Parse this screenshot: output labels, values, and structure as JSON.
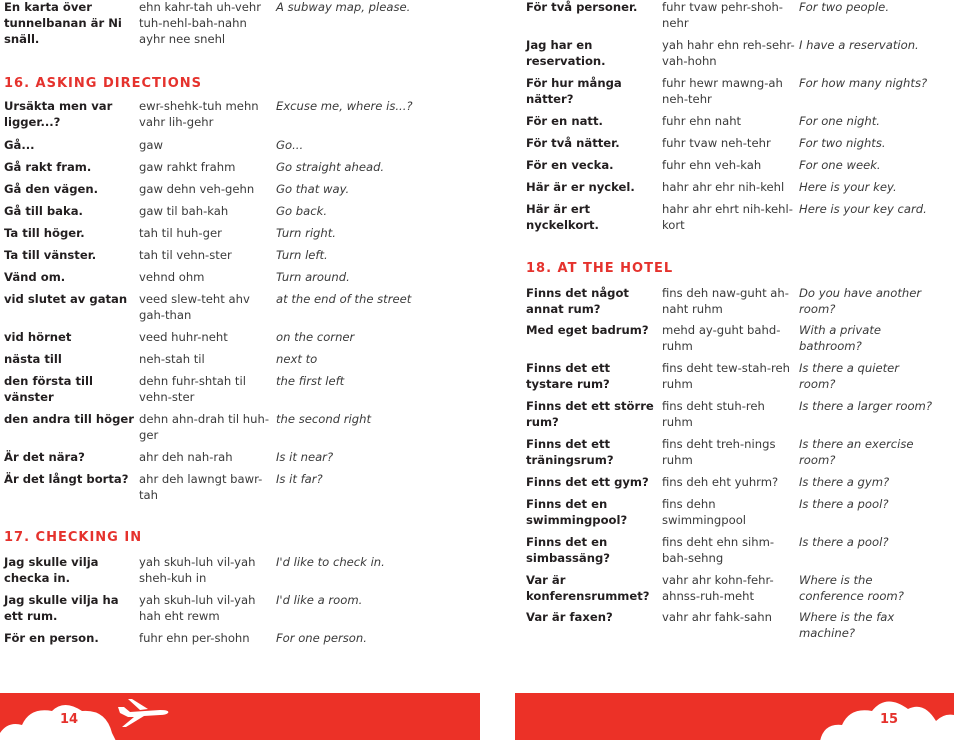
{
  "pages": [
    {
      "page_number": "14",
      "blocks": [
        {
          "type": "rows",
          "rows": [
            {
              "sv": "En karta över tunnelbanan är Ni snäll.",
              "pron": "ehn kahr-tah uh-vehr tuh-nehl-bah-nahn ayhr nee snehl",
              "en": "A subway map, please."
            }
          ]
        },
        {
          "type": "heading",
          "text": "16. ASKING DIRECTIONS"
        },
        {
          "type": "rows",
          "rows": [
            {
              "sv": "Ursäkta men var ligger...?",
              "pron": "ewr-shehk-tuh mehn vahr lih-gehr",
              "en": "Excuse me, where is...?"
            },
            {
              "sv": "Gå...",
              "pron": "gaw",
              "en": "Go..."
            },
            {
              "sv": "Gå rakt fram.",
              "pron": "gaw rahkt frahm",
              "en": "Go straight ahead."
            },
            {
              "sv": "Gå den vägen.",
              "pron": "gaw dehn veh-gehn",
              "en": "Go that way."
            },
            {
              "sv": "Gå till baka.",
              "pron": "gaw til bah-kah",
              "en": "Go back."
            },
            {
              "sv": "Ta till höger.",
              "pron": "tah til huh-ger",
              "en": "Turn right."
            },
            {
              "sv": "Ta till vänster.",
              "pron": "tah til vehn-ster",
              "en": "Turn left."
            },
            {
              "sv": "Vänd om.",
              "pron": "vehnd ohm",
              "en": "Turn around."
            },
            {
              "sv": "vid slutet av gatan",
              "pron": "veed slew-teht ahv gah-than",
              "en": "at the end of the street"
            },
            {
              "sv": "vid hörnet",
              "pron": "veed huhr-neht",
              "en": "on the corner"
            },
            {
              "sv": "nästa till",
              "pron": "neh-stah til",
              "en": "next to"
            },
            {
              "sv": "den första till vänster",
              "pron": "dehn fuhr-shtah til vehn-ster",
              "en": "the first left"
            },
            {
              "sv": "den andra till höger",
              "pron": "dehn ahn-drah til huh-ger",
              "en": "the second right"
            },
            {
              "sv": "Är det nära?",
              "pron": "ahr deh nah-rah",
              "en": "Is it near?"
            },
            {
              "sv": "Är det långt borta?",
              "pron": "ahr deh lawngt bawr-tah",
              "en": "Is it far?"
            }
          ]
        },
        {
          "type": "heading",
          "text": "17. CHECKING IN"
        },
        {
          "type": "rows",
          "rows": [
            {
              "sv": "Jag skulle vilja checka in.",
              "pron": "yah skuh-luh vil-yah sheh-kuh in",
              "en": "I'd like to check in."
            },
            {
              "sv": "Jag skulle vilja ha ett rum.",
              "pron": "yah skuh-luh vil-yah hah eht rewm",
              "en": "I'd like a room."
            },
            {
              "sv": "För en person.",
              "pron": "fuhr ehn per-shohn",
              "en": "For one person."
            }
          ]
        }
      ]
    },
    {
      "page_number": "15",
      "blocks": [
        {
          "type": "rows",
          "rows": [
            {
              "sv": "För två personer.",
              "pron": "fuhr tvaw pehr-shoh-nehr",
              "en": "For two people."
            },
            {
              "sv": "Jag har en reservation.",
              "pron": "yah hahr ehn reh-sehr-vah-hohn",
              "en": "I have a reservation."
            },
            {
              "sv": "För hur många nätter?",
              "pron": "fuhr hewr mawng-ah neh-tehr",
              "en": "For how many nights?"
            },
            {
              "sv": "För en natt.",
              "pron": "fuhr ehn naht",
              "en": "For one night."
            },
            {
              "sv": "För två nätter.",
              "pron": "fuhr tvaw neh-tehr",
              "en": "For two nights."
            },
            {
              "sv": "För en vecka.",
              "pron": "fuhr ehn veh-kah",
              "en": "For one week."
            },
            {
              "sv": "Här är er nyckel.",
              "pron": "hahr ahr ehr nih-kehl",
              "en": "Here is your key."
            },
            {
              "sv": "Här är ert nyckelkort.",
              "pron": "hahr ahr ehrt nih-kehl-kort",
              "en": "Here is your key card."
            }
          ]
        },
        {
          "type": "heading",
          "text": "18. AT THE HOTEL"
        },
        {
          "type": "rows",
          "rows": [
            {
              "sv": "Finns det något annat rum?",
              "pron": "fins deh naw-guht ah-naht ruhm",
              "en": "Do you have another room?"
            },
            {
              "sv": "Med eget badrum?",
              "pron": "mehd ay-guht bahd-ruhm",
              "en": "With a private bathroom?"
            },
            {
              "sv": "Finns det ett tystare rum?",
              "pron": "fins deht tew-stah-reh ruhm",
              "en": "Is there a quieter room?"
            },
            {
              "sv": "Finns det ett större rum?",
              "pron": "fins deht stuh-reh ruhm",
              "en": "Is there a larger room?"
            },
            {
              "sv": "Finns det ett träningsrum?",
              "pron": "fins deht treh-nings ruhm",
              "en": "Is there an exercise room?"
            },
            {
              "sv": "Finns det ett gym?",
              "pron": "fins deh eht yuhrm?",
              "en": "Is there a gym?"
            },
            {
              "sv": "Finns det en swimmingpool?",
              "pron": "fins dehn swimmingpool",
              "en": "Is there a pool?"
            },
            {
              "sv": "Finns det en simbassäng?",
              "pron": "fins deht ehn sihm-bah-sehng",
              "en": "Is there a pool?"
            },
            {
              "sv": "Var är konferensrummet?",
              "pron": "vahr ahr kohn-fehr-ahnss-ruh-meht",
              "en": "Where is the conference room?"
            },
            {
              "sv": "Var är faxen?",
              "pron": "vahr ahr fahk-sahn",
              "en": "Where is the fax machine?"
            }
          ]
        }
      ]
    }
  ],
  "colors": {
    "accent": "#e5322d",
    "footer_band": "#ec3127"
  },
  "footer_icon": "airplane-icon"
}
